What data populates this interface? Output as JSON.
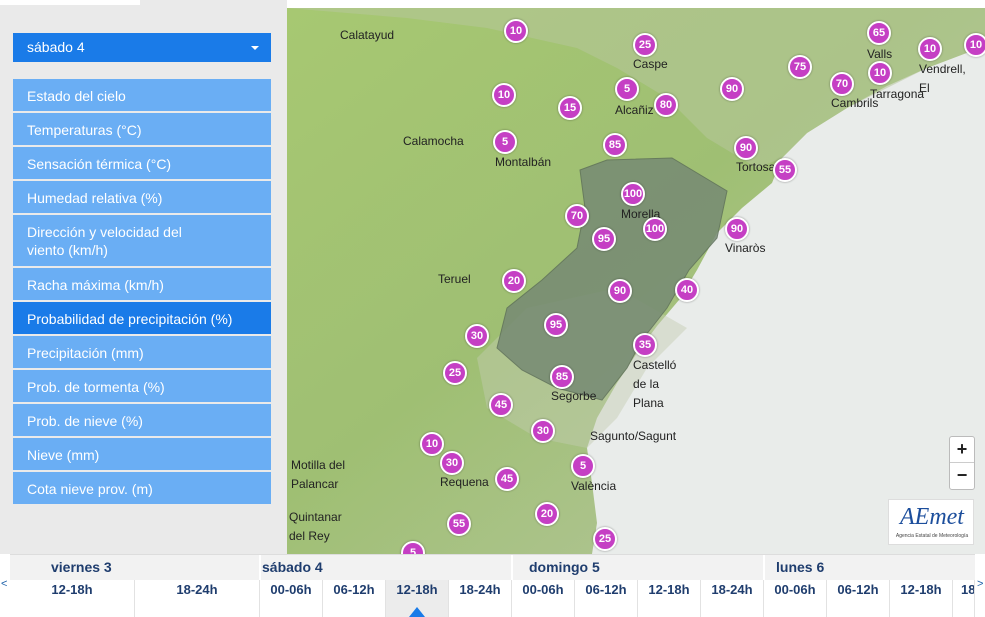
{
  "day_selector": {
    "value": "sábado 4"
  },
  "menu": [
    {
      "label": "Estado del cielo"
    },
    {
      "label": "Temperaturas (°C)"
    },
    {
      "label": "Sensación térmica (°C)"
    },
    {
      "label": "Humedad relativa (%)"
    },
    {
      "label": "Dirección y velocidad del viento (km/h)"
    },
    {
      "label": "Racha máxima (km/h)"
    },
    {
      "label": "Probabilidad de precipitación (%)",
      "active": true
    },
    {
      "label": "Precipitación (mm)"
    },
    {
      "label": "Prob. de tormenta (%)"
    },
    {
      "label": "Prob. de nieve (%)"
    },
    {
      "label": "Nieve (mm)"
    },
    {
      "label": "Cota nieve prov. (m)"
    }
  ],
  "map": {
    "places": [
      "Calatayud",
      "Caspe",
      "Valls",
      "Vendrell, El",
      "Tarragona",
      "Cambrils",
      "Alcañiz",
      "Calamocha",
      "Montalbán",
      "Tortosa",
      "Morella",
      "Vinaròs",
      "Teruel",
      "Castelló de la Plana",
      "Segorbe",
      "Sagunto/Sagunt",
      "València",
      "Motilla del Palancar",
      "Requena",
      "Quintanar del Rey"
    ],
    "values": [
      "10",
      "25",
      "65",
      "10",
      "10",
      "75",
      "70",
      "10",
      "5",
      "90",
      "10",
      "15",
      "80",
      "5",
      "85",
      "90",
      "55",
      "100",
      "70",
      "95",
      "100",
      "90",
      "20",
      "90",
      "40",
      "95",
      "30",
      "35",
      "25",
      "85",
      "45",
      "30",
      "10",
      "30",
      "5",
      "45",
      "20",
      "55",
      "25",
      "5"
    ],
    "marker_color": "#c53fc4",
    "zoom_in": "+",
    "zoom_out": "−"
  },
  "logo": {
    "text": "AEmet",
    "subtitle": "Agencia Estatal de Meteorología"
  },
  "timeline": {
    "prev": "<",
    "next": ">",
    "days": [
      "viernes 3",
      "sábado 4",
      "domingo 5",
      "lunes 6"
    ],
    "slots": [
      "12-18h",
      "18-24h",
      "00-06h",
      "06-12h",
      "12-18h",
      "18-24h",
      "00-06h",
      "06-12h",
      "12-18h",
      "18-24h",
      "00-06h",
      "06-12h",
      "12-18h",
      "18-"
    ],
    "selected_slot": "sábado 4 12-18h"
  },
  "colors": {
    "accent": "#1a7be8",
    "menu": "#6aaef4",
    "marker": "#c53fc4",
    "text_dark": "#1f3d6e"
  }
}
